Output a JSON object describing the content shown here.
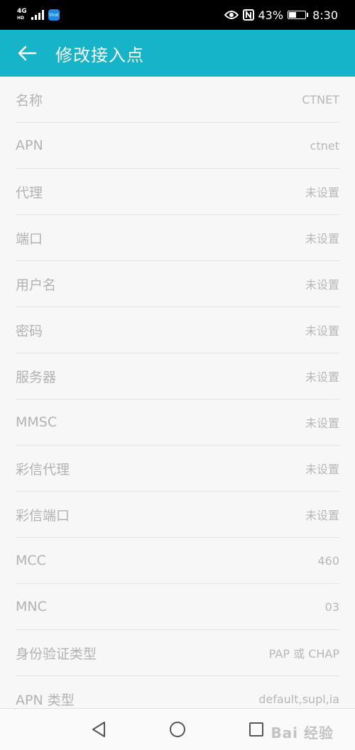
{
  "status_bar": {
    "network": "4G",
    "network_sub": "HD",
    "app_badge": "Shot",
    "battery": "43%",
    "battery_level": 0.43,
    "time": "8:30"
  },
  "app_bar": {
    "title": "修改接入点"
  },
  "fields": [
    {
      "label": "名称",
      "value": "CTNET"
    },
    {
      "label": "APN",
      "value": "ctnet"
    },
    {
      "label": "代理",
      "value": "未设置"
    },
    {
      "label": "端口",
      "value": "未设置"
    },
    {
      "label": "用户名",
      "value": "未设置"
    },
    {
      "label": "密码",
      "value": "未设置"
    },
    {
      "label": "服务器",
      "value": "未设置"
    },
    {
      "label": "MMSC",
      "value": "未设置"
    },
    {
      "label": "彩信代理",
      "value": "未设置"
    },
    {
      "label": "彩信端口",
      "value": "未设置"
    },
    {
      "label": "MCC",
      "value": "460"
    },
    {
      "label": "MNC",
      "value": "03"
    },
    {
      "label": "身份验证类型",
      "value": "PAP 或 CHAP"
    },
    {
      "label": "APN 类型",
      "value": "default,supl,ia"
    }
  ],
  "nav": {
    "icons": [
      "back-triangle-icon",
      "home-circle-icon",
      "recents-square-icon"
    ]
  },
  "watermark": "Bai 经验",
  "colors": {
    "accent": "#15b4c8",
    "background": "#f7f7f7",
    "text_muted": "#b2b2b2",
    "status_bar": "#000000"
  }
}
